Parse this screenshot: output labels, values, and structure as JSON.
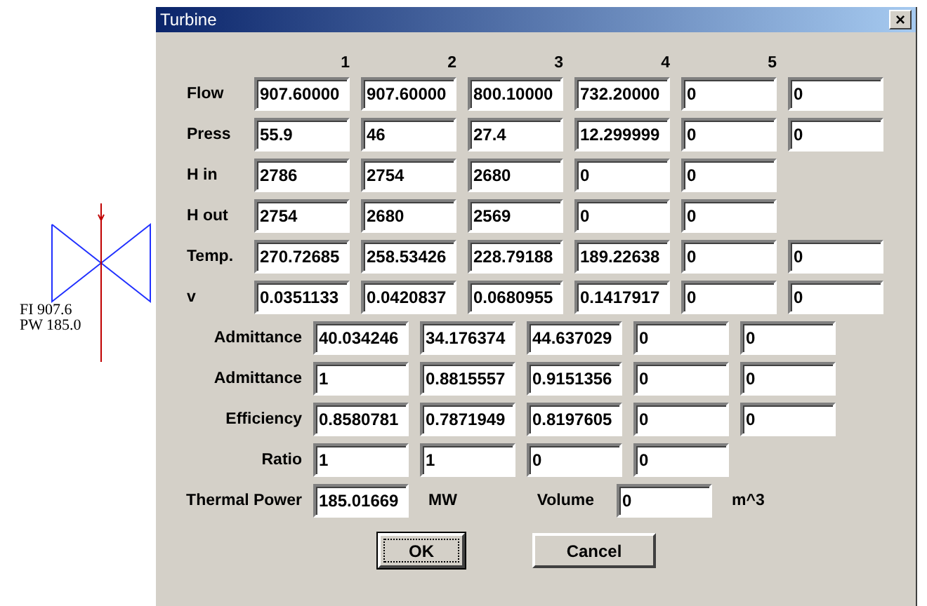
{
  "diagram": {
    "labels": [
      "FI 907.6",
      "PW 185.0"
    ]
  },
  "window": {
    "title": "Turbine",
    "close": "×"
  },
  "column_headers": [
    "1",
    "2",
    "3",
    "4",
    "5"
  ],
  "stage_rows": [
    {
      "label": "Flow",
      "values": [
        "907.60000",
        "907.60000",
        "800.10000",
        "732.20000",
        "0",
        "0"
      ]
    },
    {
      "label": "Press",
      "values": [
        "55.9",
        "46",
        "27.4",
        "12.299999",
        "0",
        "0"
      ]
    },
    {
      "label": "H in",
      "values": [
        "2786",
        "2754",
        "2680",
        "0",
        "0"
      ]
    },
    {
      "label": "H out",
      "values": [
        "2754",
        "2680",
        "2569",
        "0",
        "0"
      ]
    },
    {
      "label": "Temp.",
      "values": [
        "270.72685",
        "258.53426",
        "228.79188",
        "189.22638",
        "0",
        "0"
      ]
    },
    {
      "label": "v",
      "values": [
        "0.0351133",
        "0.0420837",
        "0.0680955",
        "0.1417917",
        "0",
        "0"
      ]
    }
  ],
  "section_rows": [
    {
      "label": "Admittance",
      "values": [
        "40.034246",
        "34.176374",
        "44.637029",
        "0",
        "0"
      ]
    },
    {
      "label": "Admittance",
      "values": [
        "1",
        "0.8815557",
        "0.9151356",
        "0",
        "0"
      ]
    },
    {
      "label": "Efficiency",
      "values": [
        "0.8580781",
        "0.7871949",
        "0.8197605",
        "0",
        "0"
      ]
    },
    {
      "label": "Ratio",
      "values": [
        "1",
        "1",
        "0",
        "0"
      ]
    }
  ],
  "thermal_power": {
    "label": "Thermal Power",
    "value": "185.01669",
    "unit": "MW"
  },
  "volume": {
    "label": "Volume",
    "value": "0",
    "unit": "m^3"
  },
  "buttons": [
    {
      "label": "OK",
      "focused": true
    },
    {
      "label": "Cancel",
      "focused": false
    }
  ]
}
